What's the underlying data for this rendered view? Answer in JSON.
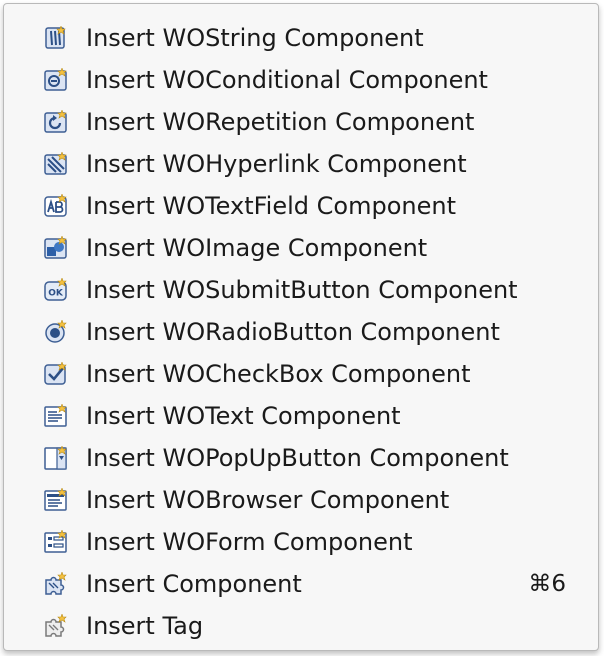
{
  "menu": {
    "items": [
      {
        "label": "Insert WOString Component",
        "icon": "wostring-icon"
      },
      {
        "label": "Insert WOConditional Component",
        "icon": "woconditional-icon"
      },
      {
        "label": "Insert WORepetition Component",
        "icon": "worepetition-icon"
      },
      {
        "label": "Insert WOHyperlink Component",
        "icon": "wohyperlink-icon"
      },
      {
        "label": "Insert WOTextField Component",
        "icon": "wotextfield-icon"
      },
      {
        "label": "Insert WOImage Component",
        "icon": "woimage-icon"
      },
      {
        "label": "Insert WOSubmitButton Component",
        "icon": "wosubmitbutton-icon"
      },
      {
        "label": "Insert WORadioButton Component",
        "icon": "woradiobutton-icon"
      },
      {
        "label": "Insert WOCheckBox Component",
        "icon": "wocheckbox-icon"
      },
      {
        "label": "Insert WOText Component",
        "icon": "wotext-icon"
      },
      {
        "label": "Insert WOPopUpButton Component",
        "icon": "wopopupbutton-icon"
      },
      {
        "label": "Insert WOBrowser Component",
        "icon": "wobrowser-icon"
      },
      {
        "label": "Insert WOForm Component",
        "icon": "woform-icon"
      },
      {
        "label": "Insert Component",
        "icon": "component-puzzle-icon",
        "shortcut": "⌘6"
      },
      {
        "label": "Insert Tag",
        "icon": "tag-puzzle-icon"
      }
    ]
  }
}
